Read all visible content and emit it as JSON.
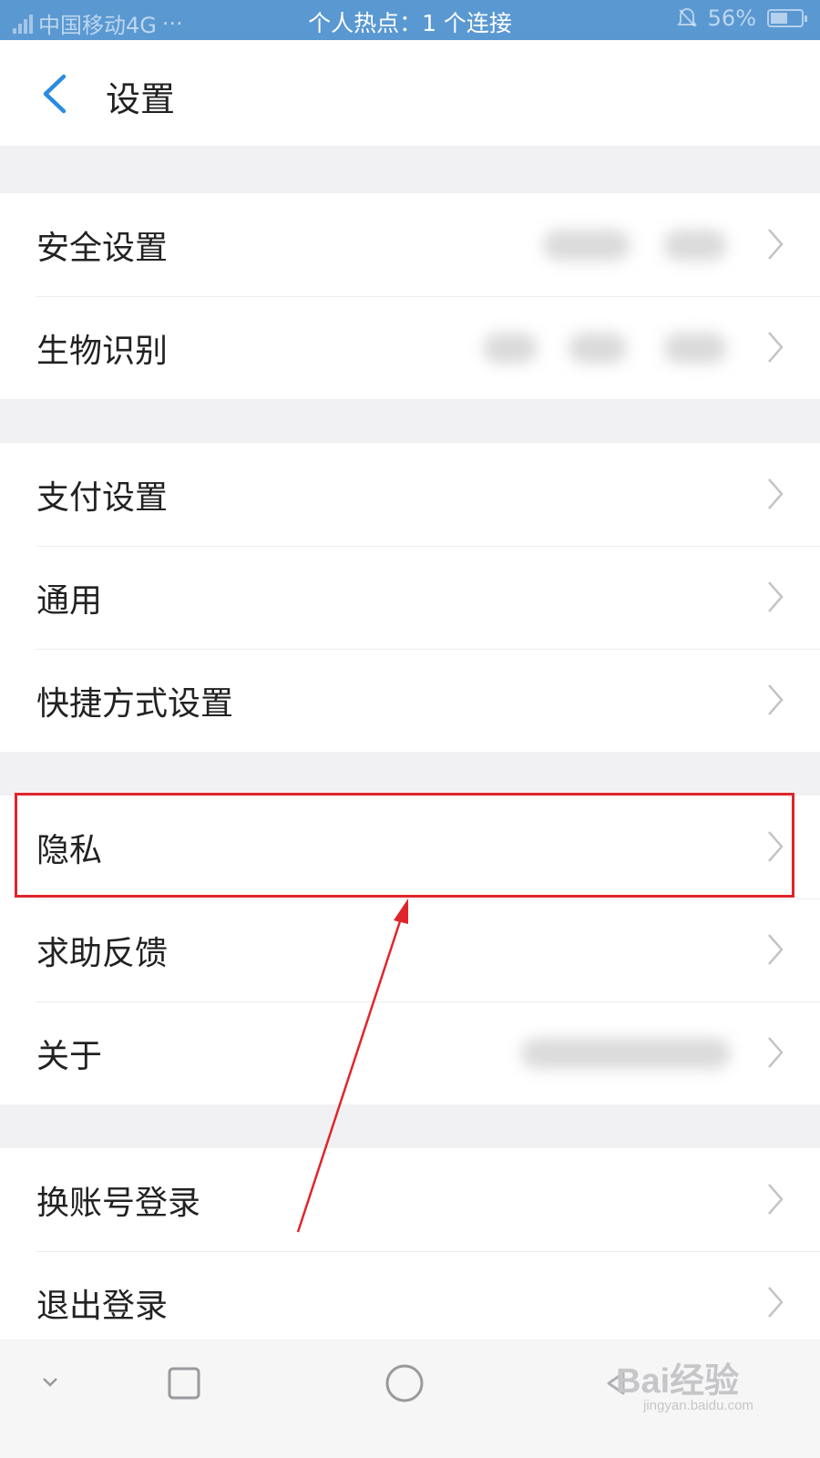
{
  "status_bar": {
    "carrier": "中国移动4G",
    "center_text": "个人热点：1 个连接",
    "battery": "56%"
  },
  "header": {
    "title": "设置"
  },
  "groups": [
    {
      "items": [
        {
          "label": "安全设置"
        },
        {
          "label": "生物识别"
        }
      ]
    },
    {
      "items": [
        {
          "label": "支付设置"
        },
        {
          "label": "通用"
        },
        {
          "label": "快捷方式设置"
        }
      ]
    },
    {
      "items": [
        {
          "label": "隐私"
        },
        {
          "label": "求助反馈"
        },
        {
          "label": "关于"
        }
      ]
    },
    {
      "items": [
        {
          "label": "换账号登录"
        },
        {
          "label": "退出登录"
        }
      ]
    }
  ],
  "watermark": {
    "main": "Bai经验",
    "sub": "jingyan.baidu.com"
  },
  "colors": {
    "accent": "#2a8be0",
    "annotation": "#e0252a",
    "status_bar": "#5a98d2"
  },
  "icons": {
    "back": "chevron-left-icon",
    "row": "chevron-right-icon"
  }
}
